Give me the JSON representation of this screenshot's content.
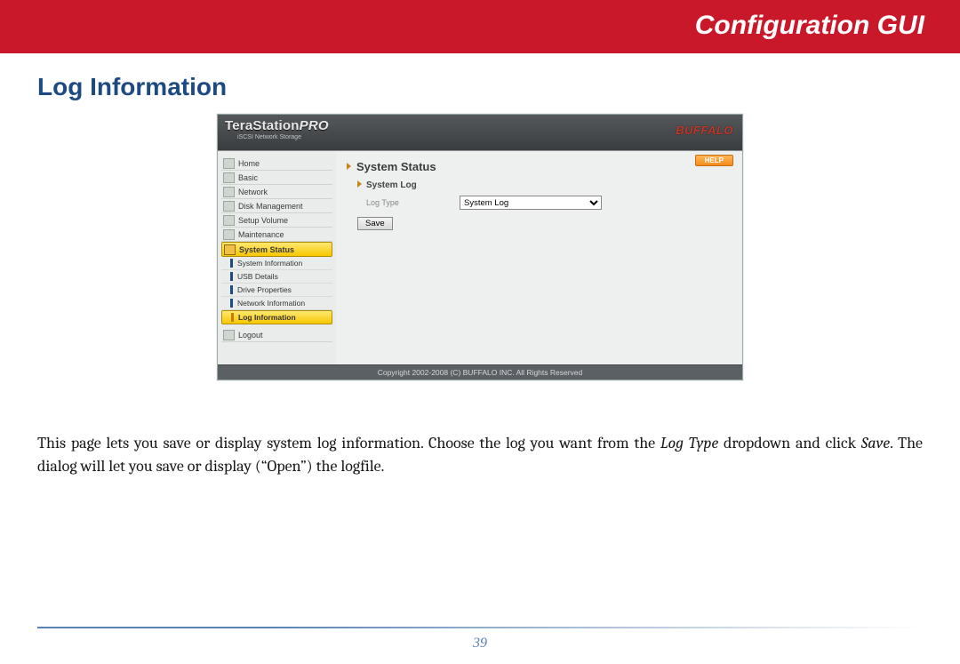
{
  "banner": {
    "title": "Configuration GUI"
  },
  "section_heading": "Log Information",
  "screenshot": {
    "brand": {
      "line1a": "TeraStation",
      "line1b": "PRO",
      "sub": "iSCSI Network Storage",
      "right": "BUFFALO"
    },
    "sidebar": {
      "items": [
        "Home",
        "Basic",
        "Network",
        "Disk Management",
        "Setup Volume",
        "Maintenance",
        "System Status"
      ],
      "selected": "System Status",
      "subitems": [
        "System Information",
        "USB Details",
        "Drive Properties",
        "Network Information",
        "Log Information"
      ],
      "sub_selected": "Log Information",
      "logout": "Logout"
    },
    "main": {
      "help": "HELP",
      "h1": "System Status",
      "h2": "System Log",
      "logtype_label": "Log Type",
      "logtype_value": "System Log",
      "save": "Save"
    },
    "copyright": "Copyright 2002-2008 (C) BUFFALO INC. All Rights Reserved"
  },
  "paragraph": {
    "p1a": "This page lets you save or display system log information.  Choose the log you want from the ",
    "p1b": "Log Type",
    "p1c": " dropdown and click ",
    "p1d": "Save",
    "p1e": ".  The dialog will let you save or display (“Open”) the logfile."
  },
  "page_number": "39"
}
